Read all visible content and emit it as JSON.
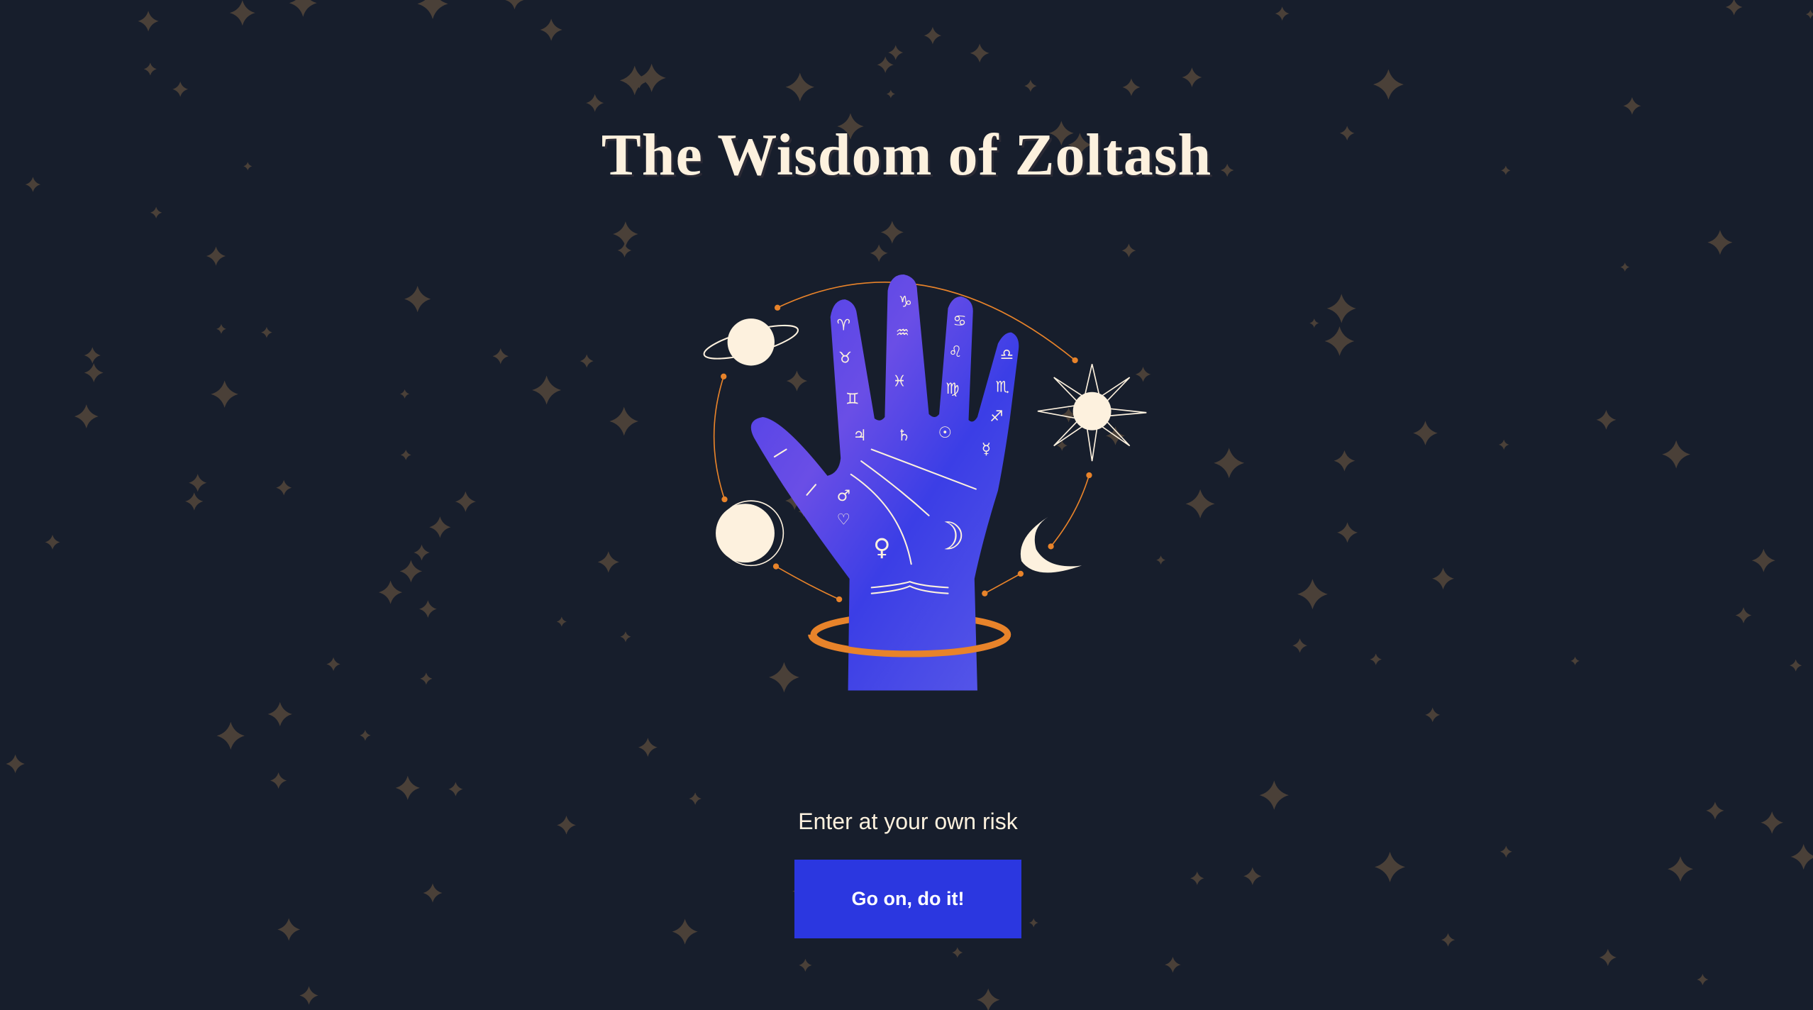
{
  "page": {
    "title": "The Wisdom of Zoltash",
    "tagline": "Enter at your own risk",
    "cta_label": "Go on, do it!"
  },
  "illustration": {
    "glyphs": [
      "♈",
      "♉",
      "♊",
      "♃",
      "♑",
      "♒",
      "♓",
      "♄",
      "♋",
      "♌",
      "♍",
      "☉",
      "♎",
      "♏",
      "♐",
      "☿",
      "♂",
      "♡",
      "♀",
      "☽"
    ]
  },
  "colors": {
    "background": "#171e2c",
    "cream": "#fdf1de",
    "button": "#2b37e0",
    "hand": "#3b3ee6",
    "orbit": "#e8832a",
    "star": "#4a4038"
  }
}
